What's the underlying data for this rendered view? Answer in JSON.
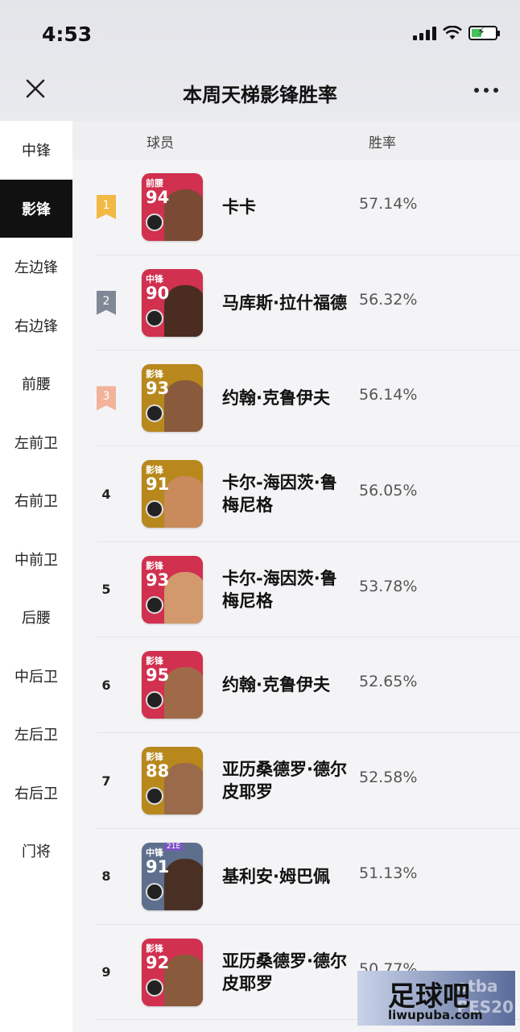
{
  "status": {
    "time": "4:53"
  },
  "header": {
    "title": "本周天梯影锋胜率"
  },
  "sidebar": {
    "items": [
      {
        "label": "中锋",
        "active": false
      },
      {
        "label": "影锋",
        "active": true
      },
      {
        "label": "左边锋",
        "active": false
      },
      {
        "label": "右边锋",
        "active": false
      },
      {
        "label": "前腰",
        "active": false
      },
      {
        "label": "左前卫",
        "active": false
      },
      {
        "label": "右前卫",
        "active": false
      },
      {
        "label": "中前卫",
        "active": false
      },
      {
        "label": "后腰",
        "active": false
      },
      {
        "label": "中后卫",
        "active": false
      },
      {
        "label": "左后卫",
        "active": false
      },
      {
        "label": "右后卫",
        "active": false
      },
      {
        "label": "门将",
        "active": false
      }
    ]
  },
  "table": {
    "col_player": "球员",
    "col_rate": "胜率",
    "rows": [
      {
        "rank": "1",
        "medal": "gold",
        "pos": "前腰",
        "rating": "94",
        "card_color": "#d1304f",
        "face": "#7a4a34",
        "name": "卡卡",
        "rate": "57.14%"
      },
      {
        "rank": "2",
        "medal": "silver",
        "pos": "中锋",
        "rating": "90",
        "card_color": "#d1304f",
        "face": "#4a2c20",
        "name": "马库斯·拉什福德",
        "rate": "56.32%"
      },
      {
        "rank": "3",
        "medal": "bronze",
        "pos": "影锋",
        "rating": "93",
        "card_color": "#b8881d",
        "face": "#8a5a3c",
        "name": "约翰·克鲁伊夫",
        "rate": "56.14%"
      },
      {
        "rank": "4",
        "medal": "",
        "pos": "影锋",
        "rating": "91",
        "card_color": "#b8881d",
        "face": "#c98a5c",
        "name": "卡尔-海因茨·鲁梅尼格",
        "rate": "56.05%"
      },
      {
        "rank": "5",
        "medal": "",
        "pos": "影锋",
        "rating": "93",
        "card_color": "#d1304f",
        "face": "#d29a6c",
        "name": "卡尔-海因茨·鲁梅尼格",
        "rate": "53.78%"
      },
      {
        "rank": "6",
        "medal": "",
        "pos": "影锋",
        "rating": "95",
        "card_color": "#d1304f",
        "face": "#a06a48",
        "name": "约翰·克鲁伊夫",
        "rate": "52.65%"
      },
      {
        "rank": "7",
        "medal": "",
        "pos": "影锋",
        "rating": "88",
        "card_color": "#b8881d",
        "face": "#9a6a4a",
        "name": "亚历桑德罗·德尔皮耶罗",
        "rate": "52.58%"
      },
      {
        "rank": "8",
        "medal": "",
        "pos": "中锋",
        "rating": "91",
        "tag": "21E",
        "card_color": "#5d6f8c",
        "face": "#4a3024",
        "name": "基利安·姆巴佩",
        "rate": "51.13%"
      },
      {
        "rank": "9",
        "medal": "",
        "pos": "影锋",
        "rating": "92",
        "card_color": "#d1304f",
        "face": "#8a5a3c",
        "name": "亚历桑德罗·德尔皮耶罗",
        "rate": "50.77%"
      }
    ]
  },
  "watermark": {
    "main": "足球吧",
    "sub": "liwupuba.com",
    "bg": "otba\nPES20"
  }
}
